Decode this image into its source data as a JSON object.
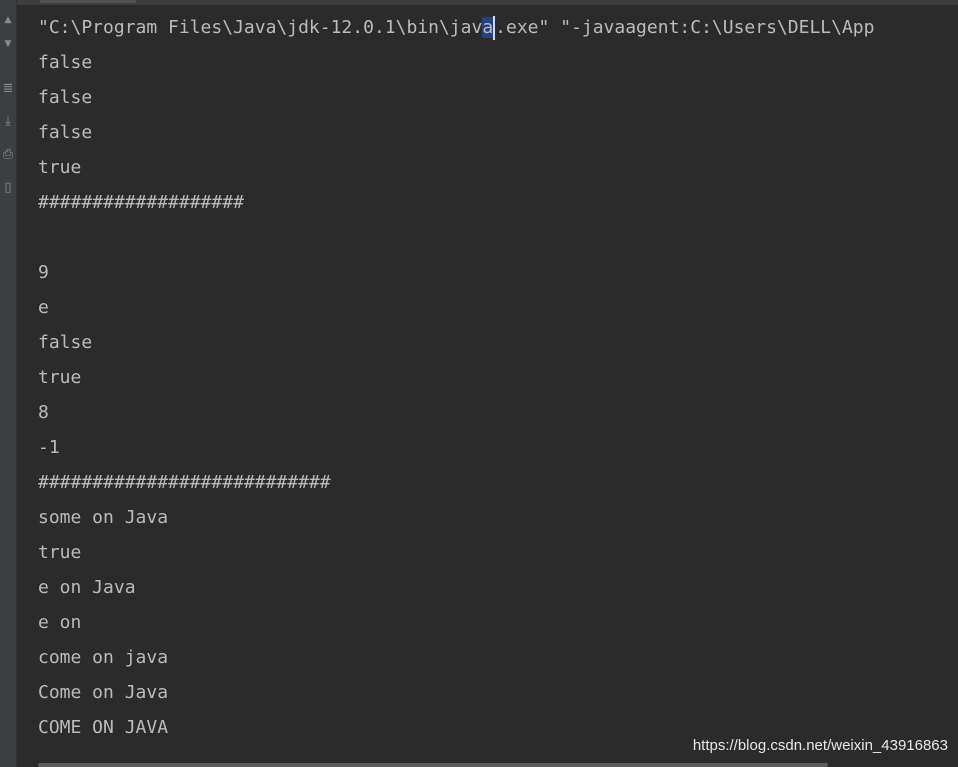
{
  "console": {
    "command_prefix": "\"C:\\Program Files\\Java\\jdk-12.0.1\\bin\\jav",
    "command_caret_char": "a",
    "command_suffix": ".exe\" \"-javaagent:C:\\Users\\DELL\\App",
    "lines": [
      "false",
      "false",
      "false",
      "true",
      "###################",
      "",
      "9",
      "e",
      "false",
      "true",
      "8",
      "-1",
      "###########################",
      "some on Java",
      "true",
      "e on Java",
      "e on",
      "come on java",
      "Come on Java",
      "COME ON JAVA"
    ]
  },
  "watermark": "https://blog.csdn.net/weixin_43916863",
  "gutter_icons": [
    "up-arrow-icon",
    "down-arrow-icon",
    "soft-wrap-icon",
    "scroll-to-end-icon",
    "print-icon",
    "trash-icon"
  ],
  "colors": {
    "background": "#2b2b2b",
    "text": "#bbbbbb",
    "selection": "#214283",
    "gutter": "#3c3f41"
  }
}
